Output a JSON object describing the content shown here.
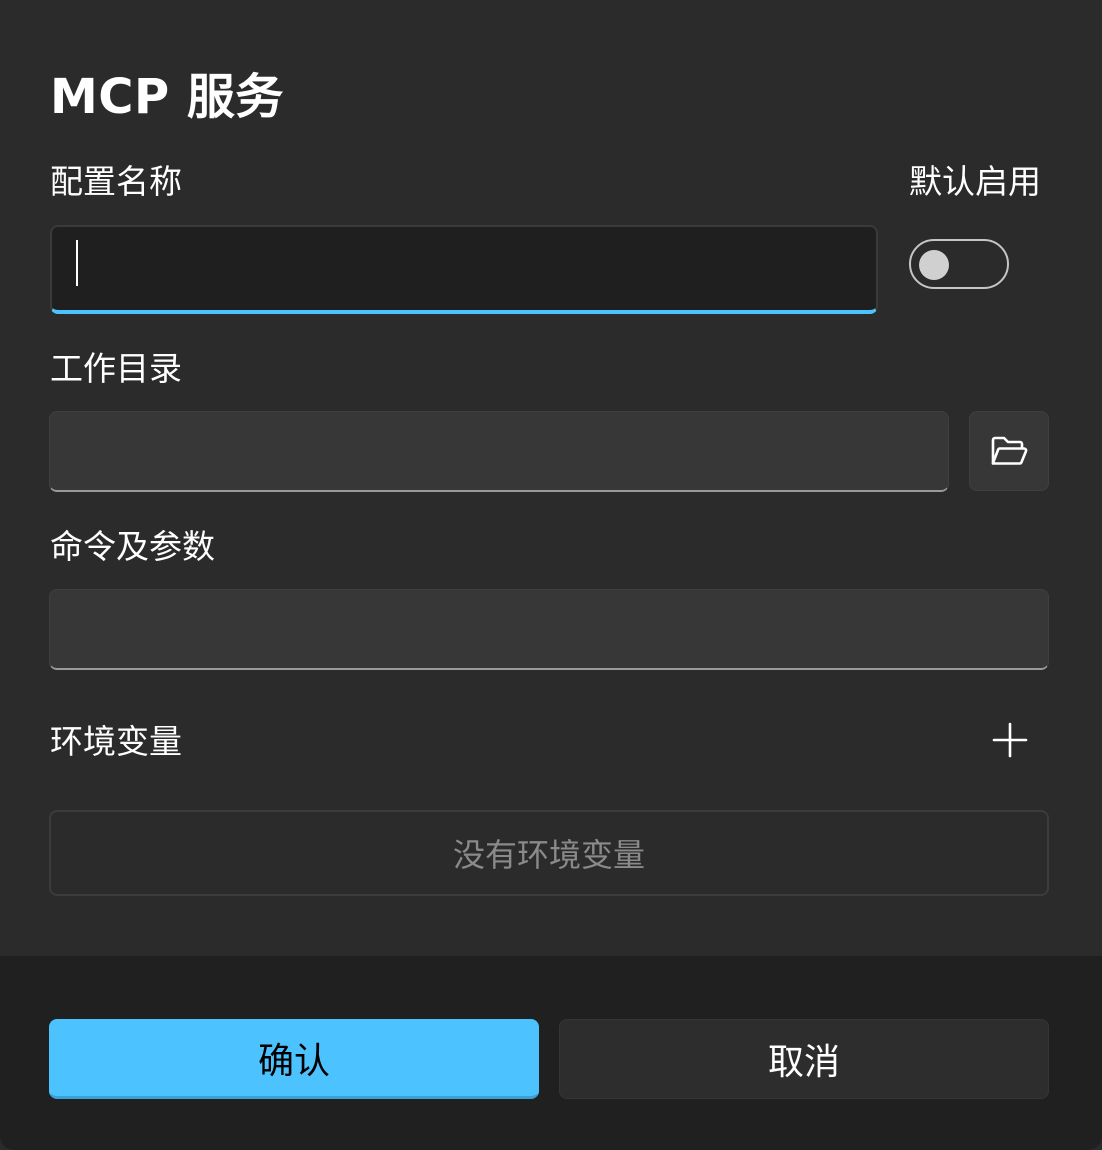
{
  "dialog": {
    "title": "MCP 服务"
  },
  "fields": {
    "config_name": {
      "label": "配置名称",
      "value": "",
      "placeholder": ""
    },
    "default_enabled": {
      "label": "默认启用",
      "checked": false
    },
    "work_dir": {
      "label": "工作目录",
      "value": "",
      "placeholder": ""
    },
    "command": {
      "label": "命令及参数",
      "value": "",
      "placeholder": ""
    },
    "env_vars": {
      "label": "环境变量",
      "empty_text": "没有环境变量"
    }
  },
  "icons": {
    "browse": "folder-open-icon",
    "add": "plus-icon"
  },
  "buttons": {
    "confirm_label": "确认",
    "cancel_label": "取消"
  },
  "colors": {
    "accent": "#4cc2ff",
    "background": "#2b2b2b",
    "footer": "#202020",
    "input_bg": "#373737"
  }
}
